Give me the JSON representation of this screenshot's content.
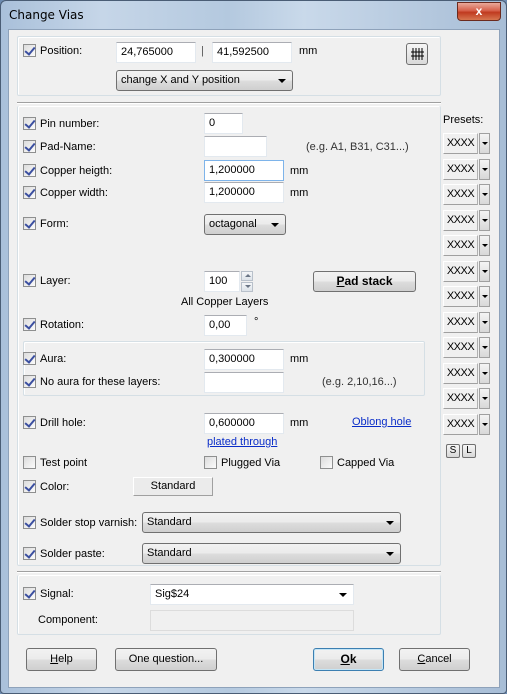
{
  "window": {
    "title": "Change Vias",
    "close_label": "x"
  },
  "position": {
    "label": "Position:",
    "checked": true,
    "x_value": "24,765000",
    "separator": "|",
    "y_value": "41,592500",
    "unit": "mm",
    "mode_selected": "change X and Y position",
    "grid_button_icon": "grid-icon"
  },
  "fields": {
    "pin_number": {
      "label": "Pin number:",
      "checked": true,
      "value": "0"
    },
    "pad_name": {
      "label": "Pad-Name:",
      "checked": true,
      "value": "",
      "hint": "(e.g. A1, B31, C31...)"
    },
    "copper_height": {
      "label": "Copper heigth:",
      "checked": true,
      "value": "1,200000",
      "unit": "mm"
    },
    "copper_width": {
      "label": "Copper width:",
      "checked": true,
      "value": "1,200000",
      "unit": "mm"
    },
    "form": {
      "label": "Form:",
      "checked": true,
      "selected": "octagonal"
    },
    "layer": {
      "label": "Layer:",
      "checked": true,
      "value": "100",
      "caption": "All Copper Layers",
      "pad_stack_label": "Pad stack",
      "pad_stack_accel": "P",
      "pad_stack_rest": "ad stack"
    },
    "rotation": {
      "label": "Rotation:",
      "checked": true,
      "value": "0,00",
      "unit": "°"
    },
    "aura": {
      "label": "Aura:",
      "checked": true,
      "value": "0,300000",
      "unit": "mm"
    },
    "no_aura": {
      "label": "No aura for these layers:",
      "checked": true,
      "value": "",
      "hint": "(e.g. 2,10,16...)"
    },
    "drill_hole": {
      "label": "Drill hole:",
      "checked": true,
      "value": "0,600000",
      "unit": "mm",
      "oblong_link": "Oblong hole",
      "plated_link": "plated through"
    },
    "test_point": {
      "label": "Test point",
      "checked": false
    },
    "plugged_via": {
      "label": "Plugged Via",
      "checked": false
    },
    "capped_via": {
      "label": "Capped Via",
      "checked": false
    },
    "color": {
      "label": "Color:",
      "checked": true,
      "button_label": "Standard"
    },
    "solder_stop": {
      "label": "Solder stop varnish:",
      "checked": true,
      "selected": "Standard"
    },
    "solder_paste": {
      "label": "Solder paste:",
      "checked": true,
      "selected": "Standard"
    }
  },
  "signal": {
    "label": "Signal:",
    "checked": true,
    "selected": "Sig$24",
    "component_label": "Component:",
    "component_value": ""
  },
  "presets": {
    "title": "Presets:",
    "items": [
      "XXXX",
      "XXXX",
      "XXXX",
      "XXXX",
      "XXXX",
      "XXXX",
      "XXXX",
      "XXXX",
      "XXXX",
      "XXXX",
      "XXXX",
      "XXXX"
    ],
    "save_label": "S",
    "load_label": "L"
  },
  "buttons": {
    "help": {
      "accel": "H",
      "rest": "elp"
    },
    "one_question": "One question...",
    "ok": {
      "accel": "O",
      "rest": "k"
    },
    "cancel": {
      "accel": "C",
      "rest": "ancel"
    }
  }
}
